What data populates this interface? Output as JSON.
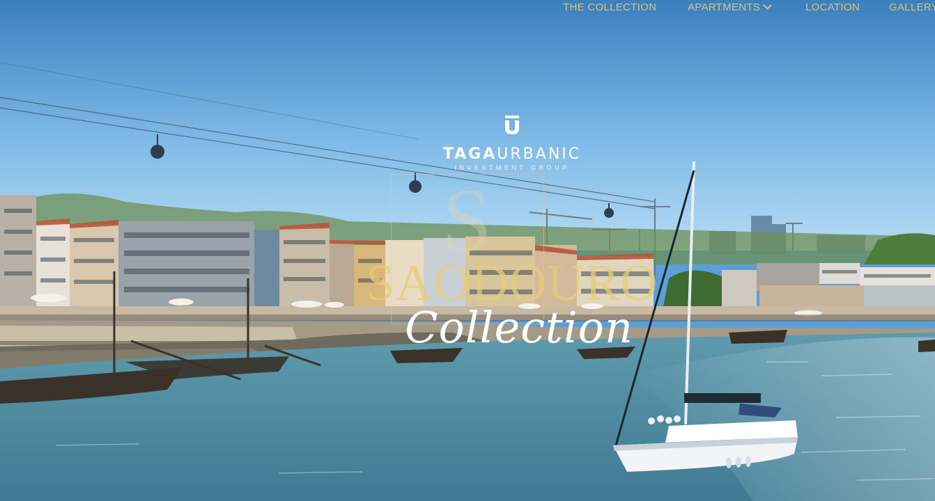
{
  "nav": {
    "items": [
      {
        "label": "THE COLLECTION"
      },
      {
        "label": "APARTMENTS"
      },
      {
        "label": "LOCATION"
      },
      {
        "label": "GALLERY"
      }
    ]
  },
  "logo": {
    "name_bold": "TAGA",
    "name_regular": "URBANIC",
    "subtitle": "INVESTMENT GROUP"
  },
  "brand": {
    "letter": "S",
    "name": "SAODOURO",
    "script": "Collection"
  },
  "colors": {
    "nav_text": "#d9c37a",
    "sky_top": "#3f86c9",
    "sky_bottom": "#9ccdf0",
    "river": "#4f8aa3",
    "gold": "#e0c670"
  },
  "icons": {
    "logo_mark": "tu-monogram-icon",
    "dropdown": "chevron-down-icon"
  }
}
